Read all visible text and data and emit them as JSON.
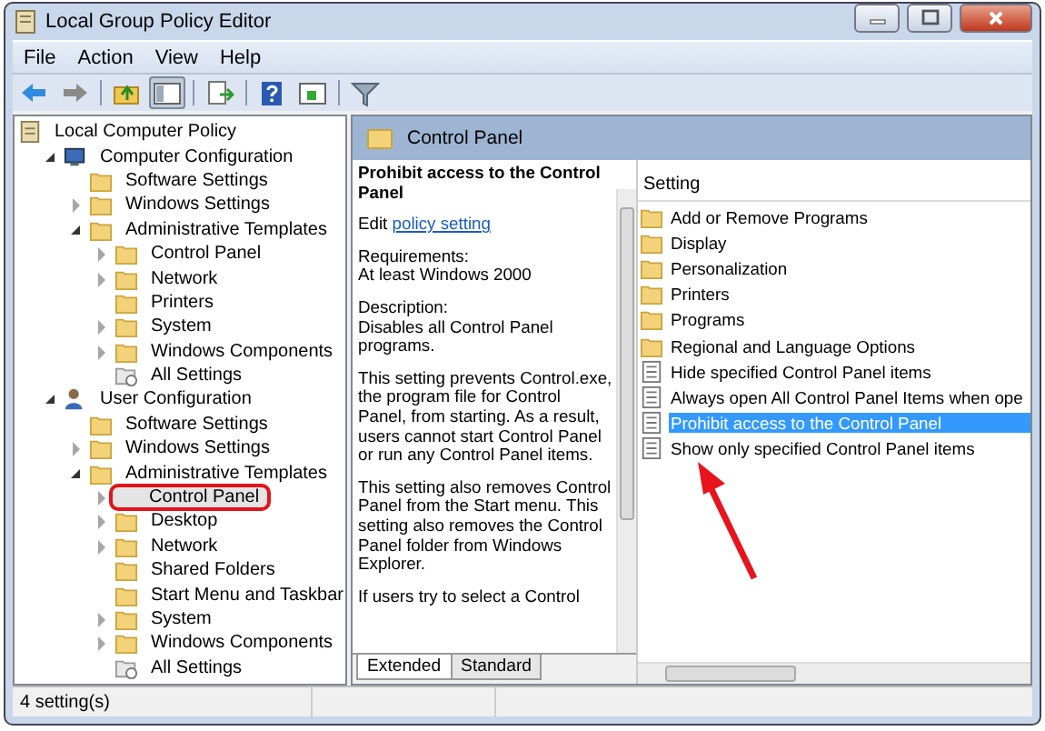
{
  "window": {
    "title": "Local Group Policy Editor"
  },
  "menu": [
    "File",
    "Action",
    "View",
    "Help"
  ],
  "toolbar": [
    {
      "kind": "back"
    },
    {
      "kind": "forward"
    },
    {
      "kind": "sep"
    },
    {
      "kind": "up"
    },
    {
      "kind": "tree",
      "selected": true
    },
    {
      "kind": "sep"
    },
    {
      "kind": "export"
    },
    {
      "kind": "sep"
    },
    {
      "kind": "help"
    },
    {
      "kind": "pane",
      "selected": false
    },
    {
      "kind": "sep"
    },
    {
      "kind": "filter"
    }
  ],
  "tree": [
    {
      "label": "Local Computer Policy",
      "kind": "policy",
      "selected": false,
      "children": [
        {
          "label": "Computer Configuration",
          "kind": "computer",
          "expanded": true,
          "selected": false,
          "children": [
            {
              "label": "Software Settings",
              "kind": "folder",
              "selected": false
            },
            {
              "label": "Windows Settings",
              "kind": "folder",
              "expanded": false,
              "selected": false
            },
            {
              "label": "Administrative Templates",
              "kind": "folder",
              "expanded": true,
              "selected": false,
              "children": [
                {
                  "label": "Control Panel",
                  "kind": "folder",
                  "expanded": false,
                  "selected": false
                },
                {
                  "label": "Network",
                  "kind": "folder",
                  "expanded": false,
                  "selected": false
                },
                {
                  "label": "Printers",
                  "kind": "folder",
                  "selected": false
                },
                {
                  "label": "System",
                  "kind": "folder",
                  "expanded": false,
                  "selected": false
                },
                {
                  "label": "Windows Components",
                  "kind": "folder",
                  "expanded": false,
                  "selected": false
                },
                {
                  "label": "All Settings",
                  "kind": "settings",
                  "selected": false
                }
              ]
            }
          ]
        },
        {
          "label": "User Configuration",
          "kind": "user",
          "expanded": true,
          "selected": false,
          "children": [
            {
              "label": "Software Settings",
              "kind": "folder",
              "selected": false
            },
            {
              "label": "Windows Settings",
              "kind": "folder",
              "expanded": false,
              "selected": false
            },
            {
              "label": "Administrative Templates",
              "kind": "folder",
              "expanded": true,
              "selected": false,
              "children": [
                {
                  "label": "Control Panel",
                  "kind": "folder",
                  "expanded": false,
                  "selected": true,
                  "highlighted": true
                },
                {
                  "label": "Desktop",
                  "kind": "folder",
                  "expanded": false,
                  "selected": false
                },
                {
                  "label": "Network",
                  "kind": "folder",
                  "expanded": false,
                  "selected": false
                },
                {
                  "label": "Shared Folders",
                  "kind": "folder",
                  "selected": false
                },
                {
                  "label": "Start Menu and Taskbar",
                  "kind": "folder",
                  "selected": false
                },
                {
                  "label": "System",
                  "kind": "folder",
                  "expanded": false,
                  "selected": false
                },
                {
                  "label": "Windows Components",
                  "kind": "folder",
                  "expanded": false,
                  "selected": false
                },
                {
                  "label": "All Settings",
                  "kind": "settings",
                  "selected": false
                }
              ]
            }
          ]
        }
      ]
    }
  ],
  "pane_header": {
    "title": "Control Panel"
  },
  "description": {
    "title": "Prohibit access to the Control Panel",
    "edit_prefix": "Edit",
    "edit_link": "policy setting",
    "paragraphs": [
      "Requirements:\nAt least Windows 2000",
      "Description:\nDisables all Control Panel programs.",
      "This setting prevents Control.exe, the program file for Control Panel, from starting. As a result, users cannot start Control Panel or run any Control Panel items.",
      "This setting also removes Control Panel from the Start menu. This setting also removes the Control Panel folder from Windows Explorer.",
      "If users try to select a Control"
    ]
  },
  "tabs": [
    {
      "label": "Extended",
      "selected": true
    },
    {
      "label": "Standard",
      "selected": false
    }
  ],
  "list": {
    "column": "Setting",
    "items": [
      {
        "label": "Add or Remove Programs",
        "kind": "folder",
        "selected": false
      },
      {
        "label": "Display",
        "kind": "folder",
        "selected": false
      },
      {
        "label": "Personalization",
        "kind": "folder",
        "selected": false
      },
      {
        "label": "Printers",
        "kind": "folder",
        "selected": false
      },
      {
        "label": "Programs",
        "kind": "folder",
        "selected": false
      },
      {
        "label": "Regional and Language Options",
        "kind": "folder",
        "selected": false
      },
      {
        "label": "Hide specified Control Panel items",
        "kind": "setting",
        "selected": false
      },
      {
        "label": "Always open All Control Panel Items when ope",
        "kind": "setting",
        "selected": false
      },
      {
        "label": "Prohibit access to the Control Panel",
        "kind": "setting",
        "selected": true
      },
      {
        "label": "Show only specified Control Panel items",
        "kind": "setting",
        "selected": false
      }
    ]
  },
  "status_bar": {
    "text": "4 setting(s)"
  }
}
